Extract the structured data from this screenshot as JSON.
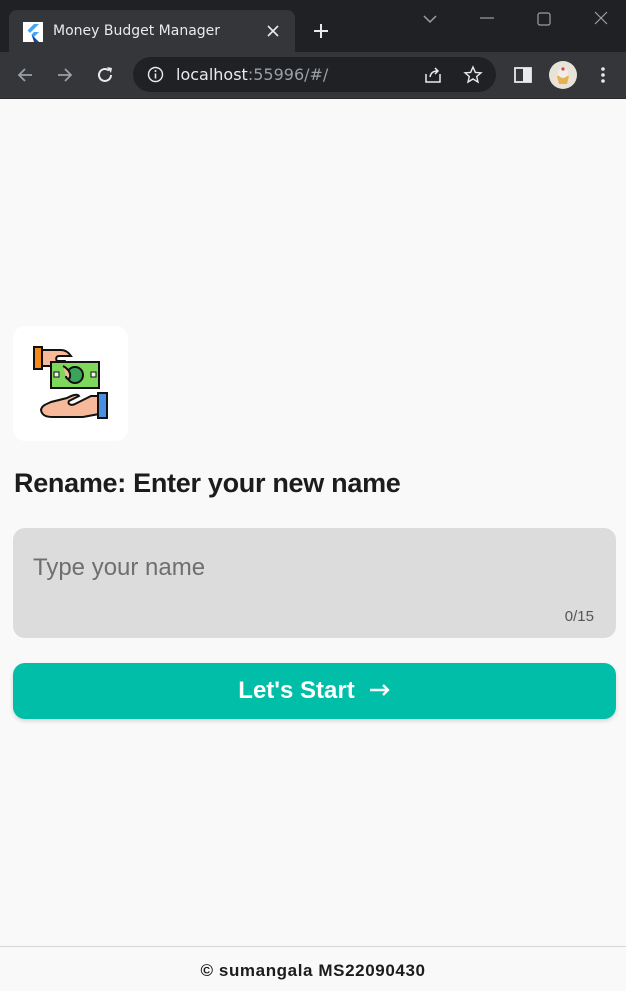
{
  "browser": {
    "tab_title": "Money Budget Manager",
    "url_host": "localhost",
    "url_rest": ":55996/#/"
  },
  "app": {
    "heading": "Rename: Enter your new name",
    "name_field": {
      "placeholder": "Type your name",
      "value": "",
      "counter": "0/15"
    },
    "start_button": {
      "label": "Let's Start"
    },
    "footer": "© sumangala MS22090430",
    "accent": "#01bea8"
  },
  "icons": [
    "flutter-favicon-icon",
    "tab-close-icon",
    "new-tab-icon",
    "back-icon",
    "forward-icon",
    "reload-icon",
    "info-icon",
    "share-icon",
    "bookmark-star-icon",
    "side-panel-icon",
    "profile-avatar",
    "menu-icon",
    "money-exchange-icon",
    "arrow-right-icon"
  ]
}
